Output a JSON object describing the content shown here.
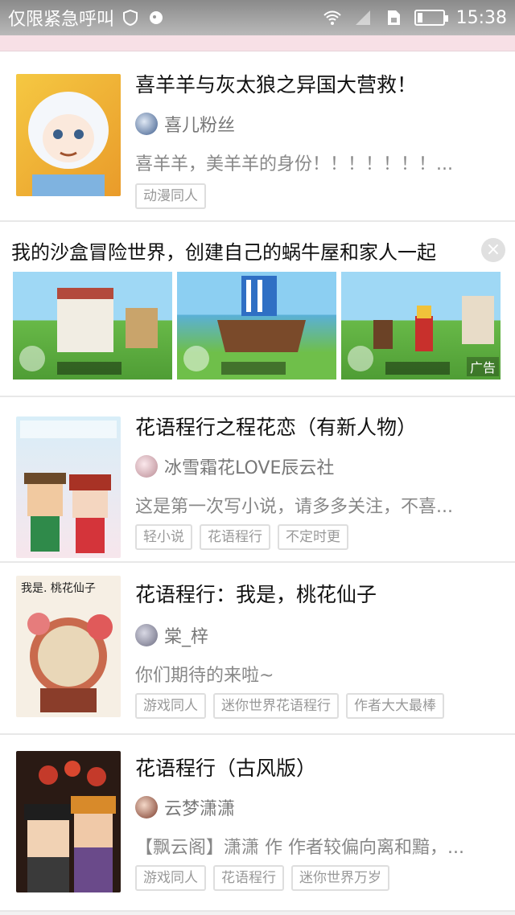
{
  "status_bar": {
    "carrier": "仅限紧急呼叫",
    "time": "15:38"
  },
  "ad": {
    "title": "我的沙盒冒险世界，创建自己的蜗牛屋和家人一起",
    "badge": "广告",
    "close": "×"
  },
  "stories": [
    {
      "title": "喜羊羊与灰太狼之异国大营救！",
      "author": "喜儿粉丝",
      "desc": "喜羊羊，美羊羊的身份！！！！！！！...",
      "tags": [
        "动漫同人"
      ]
    },
    {
      "title": "花语程行之程花恋（有新人物）",
      "author": "冰雪霜花LOVE辰云社",
      "desc": "这是第一次写小说，请多多关注，不喜...",
      "tags": [
        "轻小说",
        "花语程行",
        "不定时更"
      ]
    },
    {
      "title": "花语程行：我是，桃花仙子",
      "author": "棠_梓",
      "desc": "你们期待的来啦~",
      "tags": [
        "游戏同人",
        "迷你世界花语程行",
        "作者大大最棒"
      ]
    },
    {
      "title": "花语程行（古风版）",
      "author": "云梦潇潇",
      "desc": "【飘云阁】潇潇 作 作者较偏向离和黯，...",
      "tags": [
        "游戏同人",
        "花语程行",
        "迷你世界万岁"
      ]
    }
  ]
}
